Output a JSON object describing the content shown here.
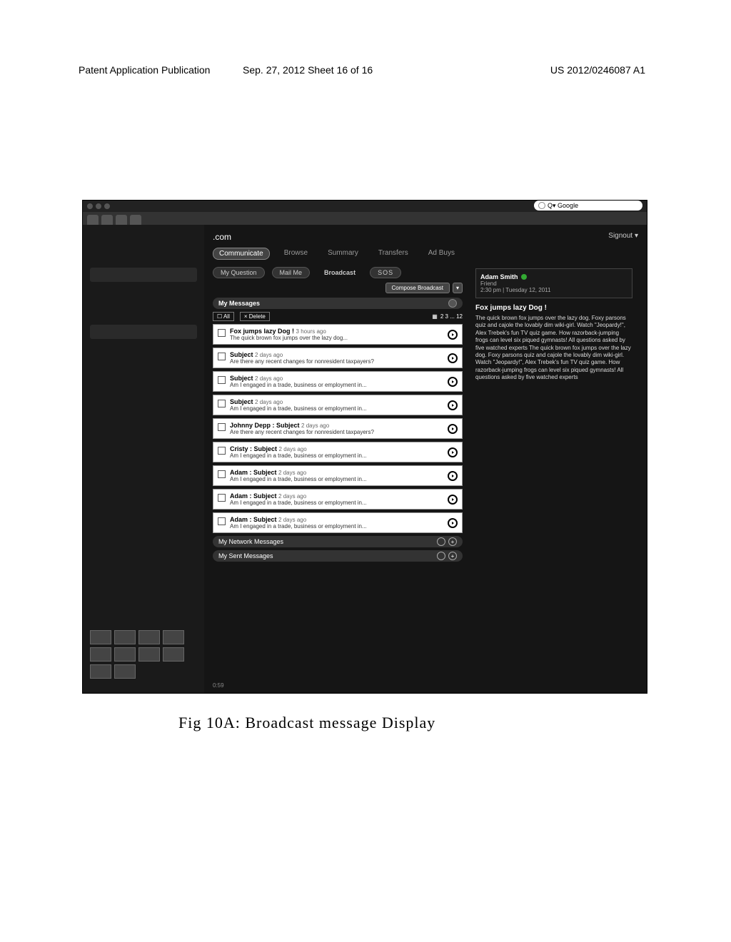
{
  "header": {
    "left": "Patent Application Publication",
    "center": "Sep. 27, 2012  Sheet 16 of 16",
    "right": "US 2012/0246087 A1"
  },
  "caption": "Fig 10A:  Broadcast  message  Display",
  "browser": {
    "search_placeholder": "Google",
    "search_prefix": "Q▾",
    "domain": ".com",
    "signout": "Signout ▾"
  },
  "nav_pills": [
    "Communicate",
    "Browse",
    "Summary",
    "Transfers",
    "Ad Buys"
  ],
  "subtabs": {
    "my_question": "My Question",
    "mail_me": "Mail Me",
    "broadcast": "Broadcast",
    "sos": "SOS"
  },
  "compose": "Compose Broadcast",
  "sections": {
    "my_messages": "My Messages",
    "my_network": "My Network Messages",
    "my_sent": "My Sent Messages"
  },
  "list_controls": {
    "all": "All",
    "delete": "× Delete",
    "pager": "2  3  ...  12"
  },
  "messages": [
    {
      "subject": "Fox jumps lazy Dog !",
      "age": "3 hours ago",
      "body": "The quick brown fox jumps over the lazy dog..."
    },
    {
      "subject": "Subject",
      "age": "2 days ago",
      "body": "Are there any recent changes for nonresident taxpayers?"
    },
    {
      "subject": "Subject",
      "age": "2 days ago",
      "body": "Am I engaged in a trade, business or employment in..."
    },
    {
      "subject": "Subject",
      "age": "2 days ago",
      "body": "Am I engaged in a trade, business or employment in..."
    },
    {
      "subject": "Johnny Depp : Subject",
      "age": "2 days ago",
      "body": "Are there any recent changes for nonresident taxpayers?"
    },
    {
      "subject": "Cristy : Subject",
      "age": "2 days ago",
      "body": "Am I engaged in a trade, business or employment in..."
    },
    {
      "subject": "Adam : Subject",
      "age": "2 days ago",
      "body": "Am I engaged in a trade, business or employment in..."
    },
    {
      "subject": "Adam : Subject",
      "age": "2 days ago",
      "body": "Am I engaged in a trade, business or employment in..."
    },
    {
      "subject": "Adam : Subject",
      "age": "2 days ago",
      "body": "Am I engaged in a trade, business or employment in..."
    }
  ],
  "right_panel": {
    "name": "Adam Smith",
    "relation": "Friend",
    "timestamp": "2:30 pm  |  Tuesday 12, 2011",
    "title": "Fox jumps lazy Dog !",
    "body": "The quick brown fox jumps over the lazy dog. Foxy parsons quiz and cajole the lovably dim wiki-girl. Watch \"Jeopardy!\", Alex Trebek's fun TV quiz game. How razorback-jumping frogs can level six piqued gymnasts! All questions asked by five watched experts The quick brown fox jumps over the lazy dog. Foxy parsons quiz and cajole the lovably dim wiki-girl. Watch \"Jeopardy!\", Alex Trebek's fun TV quiz game. How razorback-jumping frogs can level six piqued gymnasts! All questions asked by five watched experts"
  },
  "footer": {
    "left": "0:59",
    "right": " "
  }
}
